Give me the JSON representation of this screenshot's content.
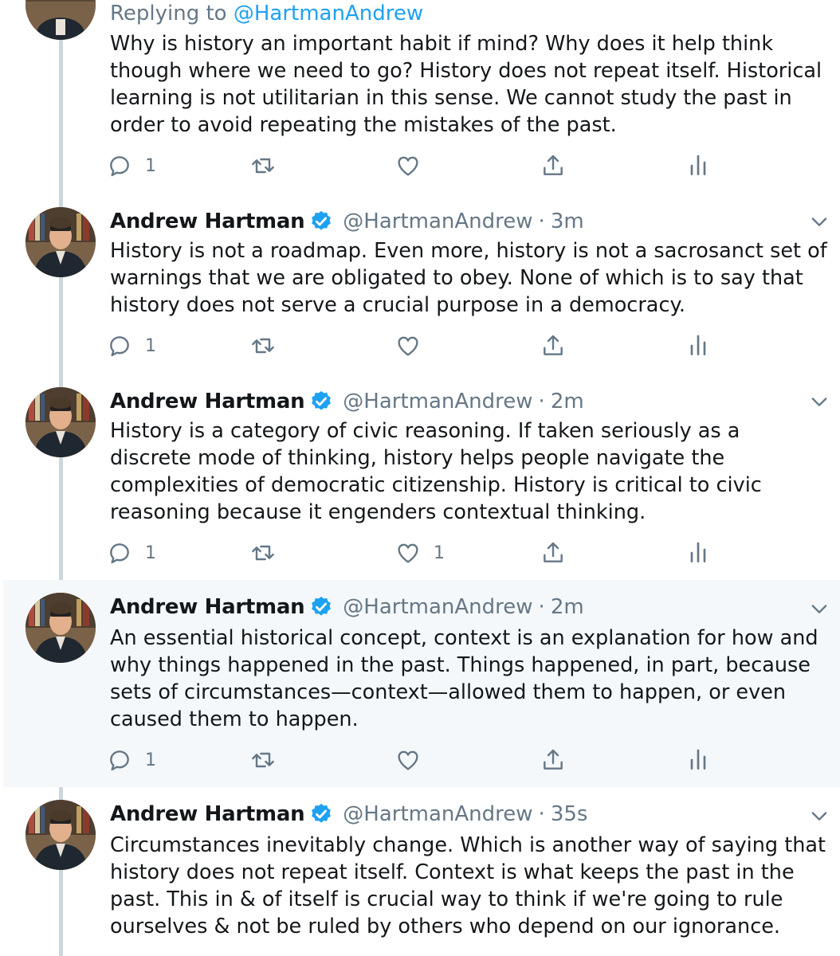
{
  "reply_context": {
    "prefix": "Replying to",
    "handle": "@HartmanAndrew"
  },
  "tweets": [
    {
      "text": "Why is history an important habit if mind? Why does it help think though where we need to go? History does not repeat itself. Historical learning is not utilitarian in this sense. We cannot study the past in order to avoid repeating the mistakes of the past.",
      "reply_count": "1",
      "retweet_count": "",
      "like_count": ""
    },
    {
      "name": "Andrew Hartman",
      "handle": "@HartmanAndrew",
      "separator": "·",
      "time": "3m",
      "text": "History is not a roadmap. Even more, history is not a sacrosanct set of warnings that we are obligated to obey. None of which is to say that history does not serve a crucial purpose in a democracy.",
      "reply_count": "1",
      "retweet_count": "",
      "like_count": ""
    },
    {
      "name": "Andrew Hartman",
      "handle": "@HartmanAndrew",
      "separator": "·",
      "time": "2m",
      "text": "History is a category of civic reasoning. If taken seriously as a discrete mode of thinking, history helps people navigate the complexities of democratic citizenship. History is critical to civic reasoning because it engenders contextual thinking.",
      "reply_count": "1",
      "retweet_count": "",
      "like_count": "1"
    },
    {
      "name": "Andrew Hartman",
      "handle": "@HartmanAndrew",
      "separator": "·",
      "time": "2m",
      "text": "An essential historical concept, context is an explanation for how and why things happened in the past. Things happened, in part, because sets of circumstances—context—allowed them to happen, or even caused them to happen.",
      "reply_count": "1",
      "retweet_count": "",
      "like_count": ""
    },
    {
      "name": "Andrew Hartman",
      "handle": "@HartmanAndrew",
      "separator": "·",
      "time": "35s",
      "text": "Circumstances inevitably change. Which is another way of saying that history does not repeat itself. Context is what keeps the past in the past. This in & of itself is crucial way to think if we're going to rule ourselves & not be ruled by others who depend on our ignorance."
    }
  ],
  "icons": {
    "reply": "speech-bubble-icon",
    "retweet": "retweet-icon",
    "like": "heart-icon",
    "share": "share-upload-icon",
    "analytics": "analytics-bars-icon",
    "verified": "verified-badge-icon",
    "more": "chevron-down-icon"
  },
  "colors": {
    "text": "#14171a",
    "secondary": "#657786",
    "accent": "#1da1f2",
    "thread_line": "#ccd6dd",
    "highlight_bg": "#f5f8fa"
  }
}
